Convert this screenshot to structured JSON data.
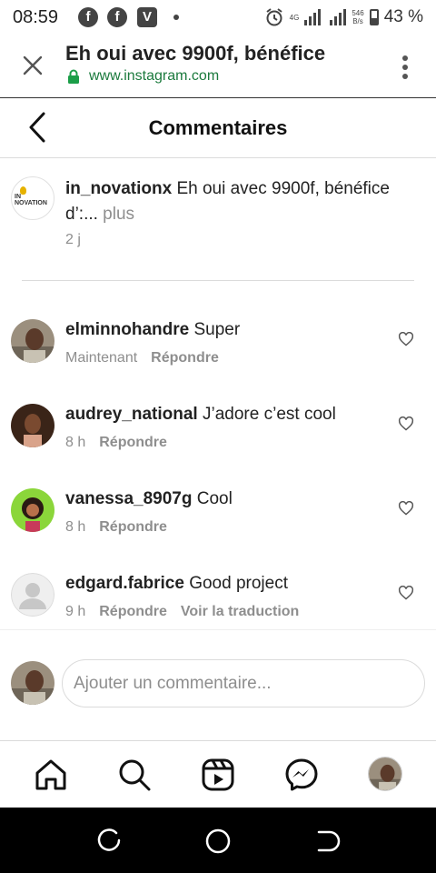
{
  "status_bar": {
    "time": "08:59",
    "notification_apps": [
      "f",
      "f",
      "V"
    ],
    "network": "4G",
    "speed_value": "546",
    "speed_unit": "B/s",
    "battery": "43 %"
  },
  "browser": {
    "title": "Eh oui avec 9900f, bénéfice",
    "url": "www.instagram.com"
  },
  "header": {
    "title": "Commentaires"
  },
  "caption": {
    "username": "in_novationx",
    "text": " Eh oui avec 9900f, bénéfice d’:...",
    "more_label": " plus",
    "time": "2 j",
    "avatar_label": "IN NOVATION"
  },
  "comments": [
    {
      "username": "elminnohandre",
      "text": " Super",
      "time": "Maintenant",
      "reply_label": "Répondre",
      "translate_label": ""
    },
    {
      "username": "audrey_national",
      "text": " J’adore c’est cool",
      "time": "8 h",
      "reply_label": "Répondre",
      "translate_label": ""
    },
    {
      "username": "vanessa_8907g",
      "text": " Cool",
      "time": "8 h",
      "reply_label": "Répondre",
      "translate_label": ""
    },
    {
      "username": "edgard.fabrice",
      "text": " Good project",
      "time": "9 h",
      "reply_label": "Répondre",
      "translate_label": "Voir la traduction"
    }
  ],
  "add_comment": {
    "placeholder": "Ajouter un commentaire..."
  },
  "colors": {
    "url_green": "#1b7a3d",
    "secondary_text": "#8e8e8e",
    "divider": "#dbdbdb"
  },
  "icons": {
    "tab_bar": [
      "home-icon",
      "search-icon",
      "reels-icon",
      "messenger-icon",
      "profile-avatar"
    ],
    "nav_bar": [
      "recent-apps-icon",
      "home-circle-icon",
      "back-icon"
    ]
  }
}
